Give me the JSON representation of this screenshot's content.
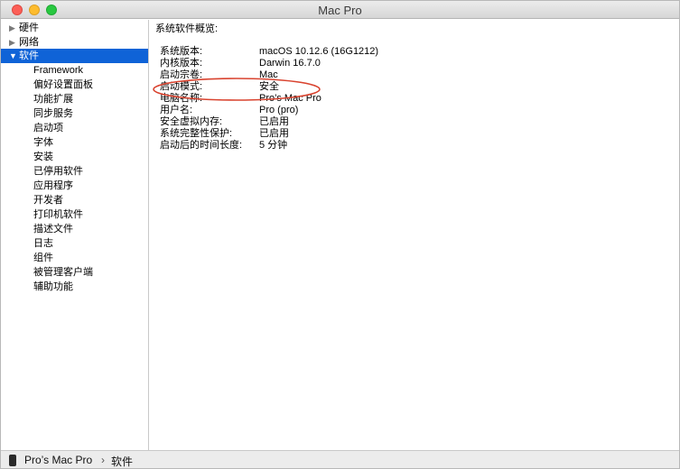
{
  "window": {
    "title": "Mac Pro"
  },
  "sidebar": {
    "top_items": [
      {
        "label": "硬件",
        "expanded": false
      },
      {
        "label": "网络",
        "expanded": false
      },
      {
        "label": "软件",
        "expanded": true,
        "selected": true
      }
    ],
    "software_children": [
      "Framework",
      "偏好设置面板",
      "功能扩展",
      "同步服务",
      "启动项",
      "字体",
      "安装",
      "已停用软件",
      "应用程序",
      "开发者",
      "打印机软件",
      "描述文件",
      "日志",
      "组件",
      "被管理客户端",
      "辅助功能"
    ]
  },
  "content": {
    "section_title": "系统软件概览:",
    "rows": [
      {
        "key": "系统版本:",
        "value": "macOS 10.12.6 (16G1212)"
      },
      {
        "key": "内核版本:",
        "value": "Darwin 16.7.0"
      },
      {
        "key": "启动宗卷:",
        "value": "Mac"
      },
      {
        "key": "启动模式:",
        "value": "安全"
      },
      {
        "key": "电脑名称:",
        "value": "Pro’s Mac Pro"
      },
      {
        "key": "用户名:",
        "value": "Pro (pro)"
      },
      {
        "key": "安全虚拟内存:",
        "value": "已启用"
      },
      {
        "key": "系统完整性保护:",
        "value": "已启用"
      },
      {
        "key": "启动后的时间长度:",
        "value": "5 分钟"
      }
    ]
  },
  "statusbar": {
    "computer": "Pro’s Mac Pro",
    "separator": "›",
    "section": "软件"
  },
  "colors": {
    "selection": "#0f63d7",
    "annotation": "#d9432f"
  },
  "icons": {
    "close": "close-icon",
    "minimize": "minimize-icon",
    "zoom": "zoom-icon",
    "collapsed": "disclosure-right-icon",
    "expanded": "disclosure-down-icon",
    "computer": "mac-pro-icon"
  }
}
